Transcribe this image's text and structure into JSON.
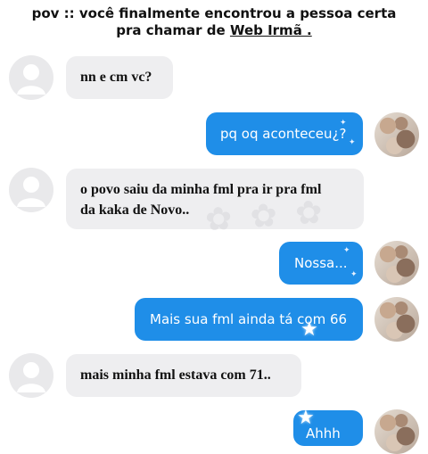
{
  "header": {
    "line1": "pov :: você finalmente encontrou a pessoa certa",
    "line2_prefix": "pra chamar de ",
    "line2_link": "Web Irmã .",
    "line2_suffix": ""
  },
  "messages": [
    {
      "side": "in",
      "text": "nn e cm vc?"
    },
    {
      "side": "out",
      "text": "pq oq aconteceu¿?"
    },
    {
      "side": "in",
      "text": "o povo saiu da minha fml pra ir pra fml da kaka de Novo.."
    },
    {
      "side": "out",
      "text": "Nossa..."
    },
    {
      "side": "out",
      "text": "Mais sua fml ainda tá com 66"
    },
    {
      "side": "in",
      "text": "mais minha fml estava com 71.."
    },
    {
      "side": "out",
      "text": "Ahhh"
    }
  ],
  "icons": {
    "default_avatar": "default-avatar-icon",
    "photo_avatar": "profile-photo-avatar",
    "decoration": "star-sticker-icon"
  },
  "colors": {
    "outgoing_bubble": "#1f8ee8",
    "incoming_bubble": "#eeeef0",
    "background": "#ffffff"
  }
}
